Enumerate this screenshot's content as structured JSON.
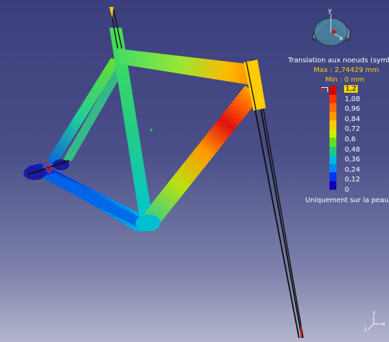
{
  "legend": {
    "title": "Translation aux noeuds (symbo",
    "max": "Max : 2,74429 mm",
    "min": "Min : 0 mm",
    "ticks": [
      "1,2",
      "1,08",
      "0,96",
      "0,84",
      "0,72",
      "0,6",
      "0,48",
      "0,36",
      "0,24",
      "0,12",
      "0"
    ],
    "colors": [
      "#d60000",
      "#ff3300",
      "#ff6a00",
      "#ff9a00",
      "#ffcc00",
      "#ccee00",
      "#66dd22",
      "#22cc77",
      "#00b8d8",
      "#0088ff",
      "#0033ee",
      "#0a00b8"
    ],
    "note": "Uniquement sur la peau"
  },
  "compass": {
    "axis_y": "y",
    "axis_x": "x"
  },
  "triad": {
    "axis_y": "y",
    "axis_x": "x",
    "axis_z": "z"
  },
  "colors": {
    "background_top": "#3a3f7c",
    "background_bottom": "#b4b6cf",
    "legend_value_color": "#f2d500",
    "constraint_color": "#e02020"
  },
  "model": {
    "description_icon": "bicycle-frame-mesh"
  }
}
